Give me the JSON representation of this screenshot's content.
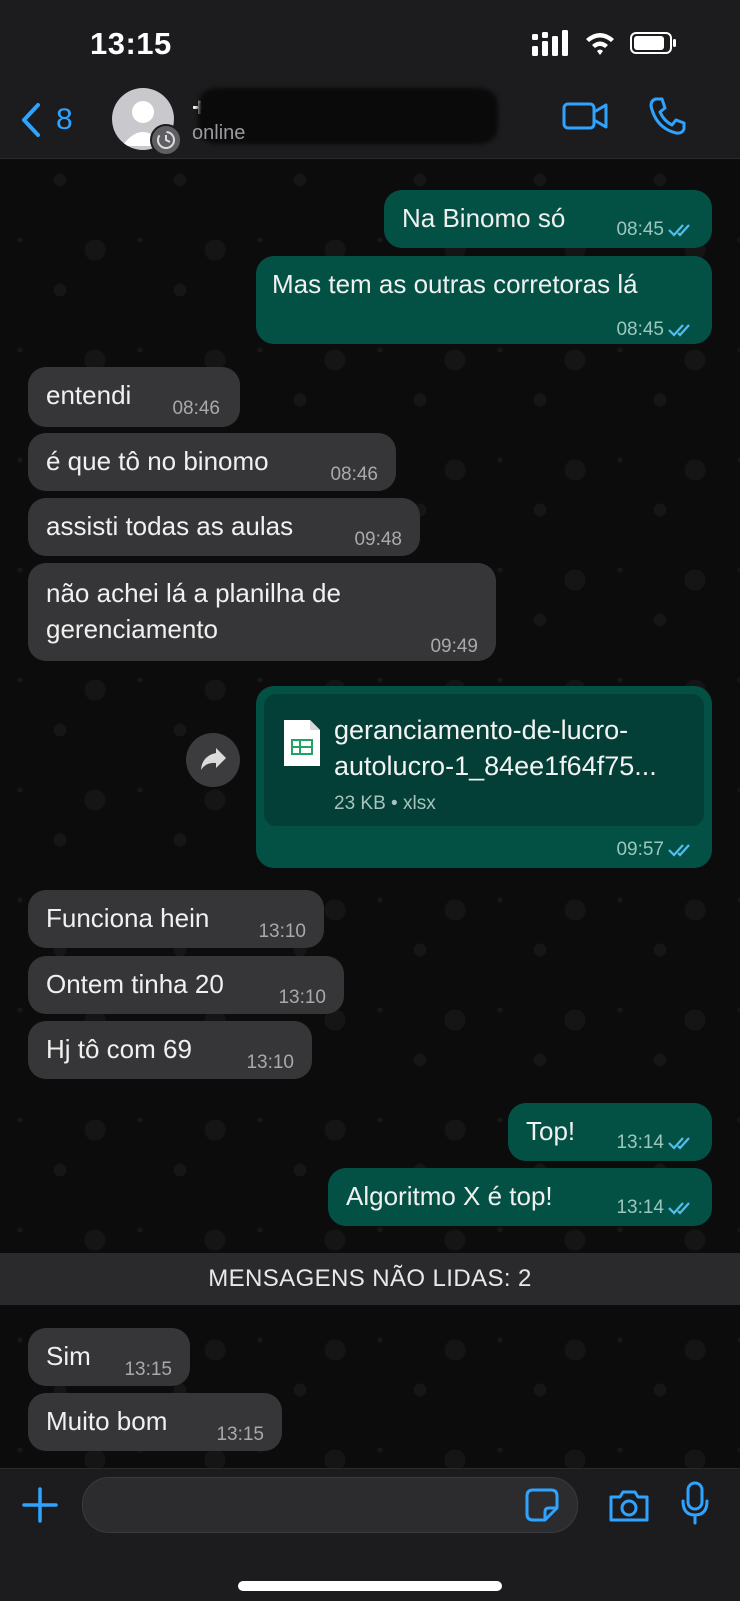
{
  "status_bar": {
    "time": "13:15"
  },
  "header": {
    "back_count": "8",
    "contact_name": "+5",
    "contact_status": "online"
  },
  "messages": [
    {
      "text": "Na Binomo só",
      "time": "08:45",
      "direction": "out",
      "read": true
    },
    {
      "text": "Mas tem as outras corretoras lá",
      "time": "08:45",
      "direction": "out",
      "read": true
    },
    {
      "text": "entendi",
      "time": "08:46",
      "direction": "in"
    },
    {
      "text": "é que tô no binomo",
      "time": "08:46",
      "direction": "in"
    },
    {
      "text": "assisti todas as aulas",
      "time": "09:48",
      "direction": "in"
    },
    {
      "text": "não achei lá a planilha de gerenciamento",
      "time": "09:49",
      "direction": "in"
    },
    {
      "type": "file",
      "file_name": "geranciamento-de-lucro-autolucro-1_84ee1f64f75...",
      "file_size": "23 KB",
      "file_ext": "xlsx",
      "time": "09:57",
      "direction": "out",
      "read": true
    },
    {
      "text": "Funciona hein",
      "time": "13:10",
      "direction": "in"
    },
    {
      "text": "Ontem tinha 20",
      "time": "13:10",
      "direction": "in"
    },
    {
      "text": "Hj tô com 69",
      "time": "13:10",
      "direction": "in"
    },
    {
      "text": "Top!",
      "time": "13:14",
      "direction": "out",
      "read": true
    },
    {
      "text": "Algoritmo X é top!",
      "time": "13:14",
      "direction": "out",
      "read": true
    },
    {
      "text": "Sim",
      "time": "13:15",
      "direction": "in"
    },
    {
      "text": "Muito bom",
      "time": "13:15",
      "direction": "in"
    }
  ],
  "unread_separator": "MENSAGENS NÃO LIDAS: 2",
  "file_meta_separator": " • ",
  "colors": {
    "accent": "#2ea3ff",
    "outgoing_bubble": "#035145",
    "incoming_bubble": "#363638",
    "read_ticks": "#53bdeb"
  },
  "icons": [
    "back-chevron-icon",
    "video-call-icon",
    "phone-icon",
    "spreadsheet-file-icon",
    "forward-icon",
    "plus-icon",
    "sticker-icon",
    "camera-icon",
    "microphone-icon"
  ]
}
